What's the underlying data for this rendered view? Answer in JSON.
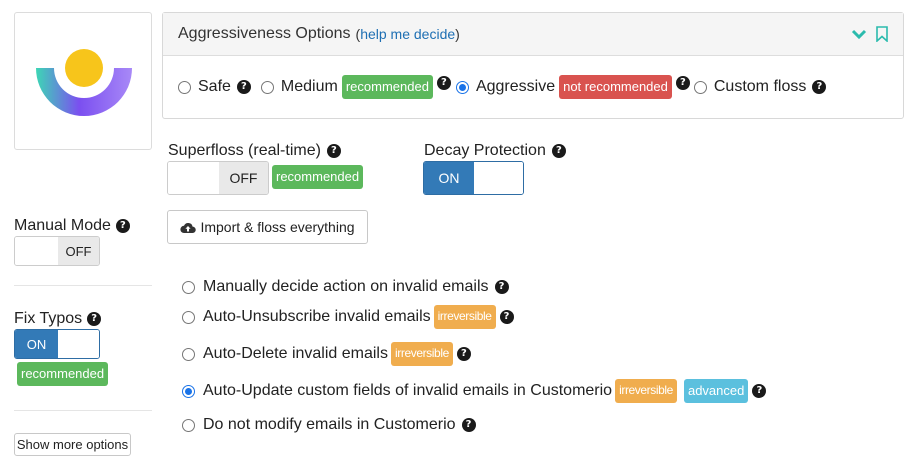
{
  "aggressiveness": {
    "title": "Aggressiveness Options",
    "paren_open": "(",
    "help_link": "help me decide",
    "paren_close": ")",
    "icons": [
      "chevron-down-icon",
      "bookmark-icon"
    ],
    "options": [
      {
        "label": "Safe",
        "checked": false
      },
      {
        "label": "Medium",
        "badge": "recommended",
        "checked": false
      },
      {
        "label": "Aggressive",
        "badge": "not recommended",
        "checked": true
      },
      {
        "label": "Custom floss",
        "checked": false
      }
    ]
  },
  "superfloss": {
    "label": "Superfloss (real-time)",
    "state": "OFF",
    "badge": "recommended"
  },
  "decay": {
    "label": "Decay Protection",
    "state": "ON"
  },
  "manual_mode": {
    "label": "Manual Mode",
    "state": "OFF"
  },
  "import_button": {
    "label": "Import & floss everything",
    "icon": "cloud-upload-icon"
  },
  "fix_typos": {
    "label": "Fix Typos",
    "state": "ON",
    "badge": "recommended"
  },
  "show_more": {
    "label": "Show more options"
  },
  "invalid_email_options": [
    {
      "label": "Manually decide action on invalid emails",
      "checked": false
    },
    {
      "label": "Auto-Unsubscribe invalid emails",
      "badge": "irreversible",
      "checked": false
    },
    {
      "label": "Auto-Delete invalid emails",
      "badge": "irreversible",
      "checked": false
    },
    {
      "label": "Auto-Update custom fields of invalid emails in Customerio",
      "badge": "irreversible",
      "badge2": "advanced",
      "checked": true
    },
    {
      "label": "Do not modify emails in Customerio",
      "checked": false
    }
  ],
  "help_glyph": "?",
  "colors": {
    "green": "#5cb85c",
    "red": "#d9534f",
    "orange": "#f0ad4e",
    "blue_badge": "#5bc0de",
    "toggle_on": "#337ab7",
    "teal_icon": "#2bbbad",
    "logo_teal": "#3dd6b5",
    "logo_purple": "#7b4ff0",
    "logo_yellow": "#f7c51b"
  }
}
